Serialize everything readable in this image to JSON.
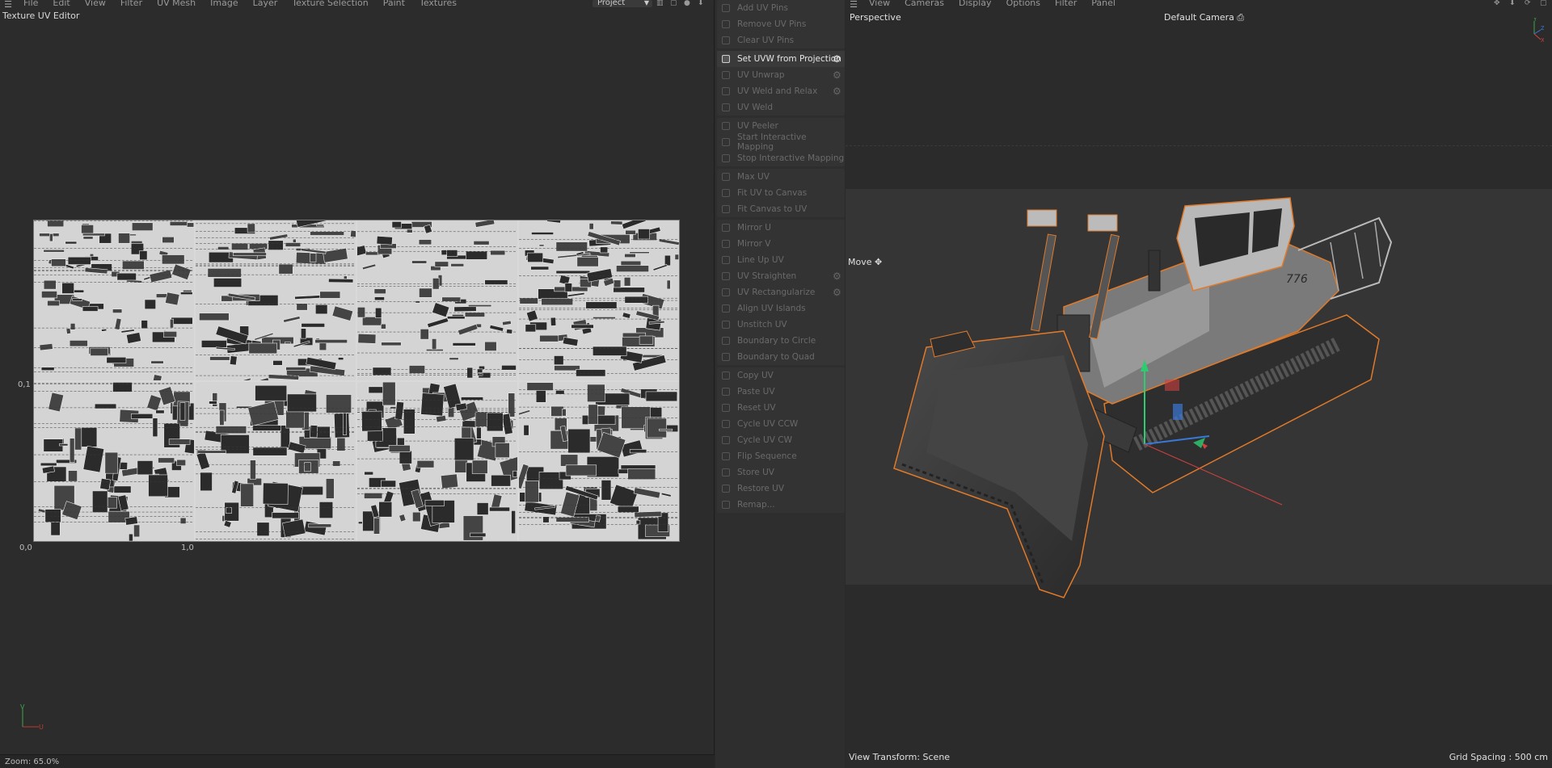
{
  "uv_editor": {
    "menu": [
      "File",
      "Edit",
      "View",
      "Filter",
      "UV Mesh",
      "Image",
      "Layer",
      "Texture Selection",
      "Paint",
      "Textures"
    ],
    "title": "Texture UV Editor",
    "project_dropdown": "Project",
    "labels": {
      "origin": "0,0",
      "u_one": "1,0",
      "v_one": "0,1"
    },
    "axis": {
      "v": "V",
      "u": "U"
    },
    "status": "Zoom: 65.0%"
  },
  "uv_commands": {
    "groups": [
      [
        {
          "label": "Add UV Pins",
          "active": false,
          "gear": false
        },
        {
          "label": "Remove UV Pins",
          "active": false,
          "gear": false
        },
        {
          "label": "Clear UV Pins",
          "active": false,
          "gear": false
        }
      ],
      [
        {
          "label": "Set UVW from Projection",
          "active": true,
          "gear": true
        },
        {
          "label": "UV Unwrap",
          "active": false,
          "gear": true
        },
        {
          "label": "UV Weld and Relax",
          "active": false,
          "gear": true
        },
        {
          "label": "UV Weld",
          "active": false,
          "gear": false
        }
      ],
      [
        {
          "label": "UV Peeler",
          "active": false,
          "gear": false
        },
        {
          "label": "Start Interactive Mapping",
          "active": false,
          "gear": false
        },
        {
          "label": "Stop Interactive Mapping",
          "active": false,
          "gear": false
        }
      ],
      [
        {
          "label": "Max UV",
          "active": false,
          "gear": false
        },
        {
          "label": "Fit UV to Canvas",
          "active": false,
          "gear": false
        },
        {
          "label": "Fit Canvas to UV",
          "active": false,
          "gear": false
        }
      ],
      [
        {
          "label": "Mirror U",
          "active": false,
          "gear": false
        },
        {
          "label": "Mirror V",
          "active": false,
          "gear": false
        },
        {
          "label": "Line Up UV",
          "active": false,
          "gear": false
        },
        {
          "label": "UV Straighten",
          "active": false,
          "gear": true
        },
        {
          "label": "UV Rectangularize",
          "active": false,
          "gear": true
        },
        {
          "label": "Align UV Islands",
          "active": false,
          "gear": false
        },
        {
          "label": "Unstitch UV",
          "active": false,
          "gear": false
        },
        {
          "label": "Boundary to Circle",
          "active": false,
          "gear": false
        },
        {
          "label": "Boundary to Quad",
          "active": false,
          "gear": false
        }
      ],
      [
        {
          "label": "Copy UV",
          "active": false,
          "gear": false
        },
        {
          "label": "Paste UV",
          "active": false,
          "gear": false
        },
        {
          "label": "Reset UV",
          "active": false,
          "gear": false
        },
        {
          "label": "Cycle UV CCW",
          "active": false,
          "gear": false
        },
        {
          "label": "Cycle UV CW",
          "active": false,
          "gear": false
        },
        {
          "label": "Flip Sequence",
          "active": false,
          "gear": false
        },
        {
          "label": "Store UV",
          "active": false,
          "gear": false
        },
        {
          "label": "Restore UV",
          "active": false,
          "gear": false
        },
        {
          "label": "Remap...",
          "active": false,
          "gear": false
        }
      ]
    ]
  },
  "viewport": {
    "menu": [
      "View",
      "Cameras",
      "Display",
      "Options",
      "Filter",
      "Panel"
    ],
    "view_name": "Perspective",
    "camera": "Default Camera",
    "tool": "Move",
    "status_left": "View Transform: Scene",
    "status_right": "Grid Spacing : 500 cm",
    "model_badge": "776",
    "selection_color": "#e07a2a",
    "axis": {
      "y": "Y",
      "z": "Z",
      "x": "X"
    }
  }
}
